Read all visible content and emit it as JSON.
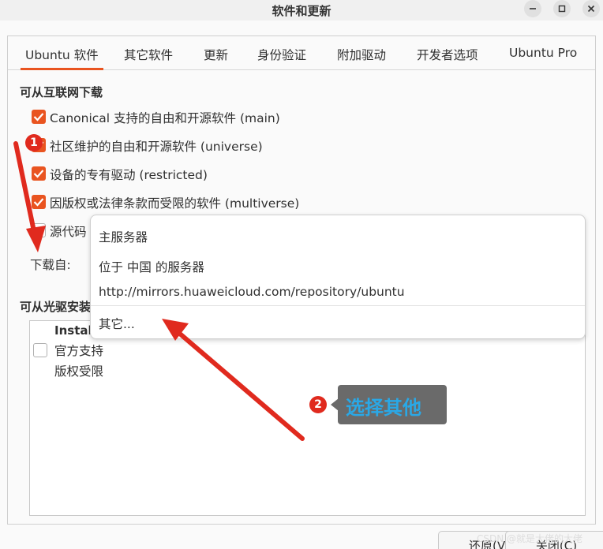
{
  "window": {
    "title": "软件和更新"
  },
  "tabs": [
    {
      "label": "Ubuntu 软件"
    },
    {
      "label": "其它软件"
    },
    {
      "label": "更新"
    },
    {
      "label": "身份验证"
    },
    {
      "label": "附加驱动"
    },
    {
      "label": "开发者选项"
    },
    {
      "label": "Ubuntu Pro"
    }
  ],
  "internet": {
    "heading": "可从互联网下载",
    "items": [
      {
        "label": "Canonical 支持的自由和开源软件 (main)",
        "checked": true
      },
      {
        "label": "社区维护的自由和开源软件 (universe)",
        "checked": true
      },
      {
        "label": "设备的专有驱动 (restricted)",
        "checked": true
      },
      {
        "label": "因版权或法律条款而受限的软件 (multiverse)",
        "checked": true
      },
      {
        "label": "源代码",
        "checked": false
      }
    ],
    "download_from_label": "下载自:"
  },
  "cdrom": {
    "heading": "可从光驱安装",
    "header": "Install",
    "line1": "官方支持",
    "line2": "版权受限"
  },
  "server_menu": {
    "items": [
      {
        "label": "主服务器"
      },
      {
        "label": "位于 中国 的服务器"
      },
      {
        "label": "http://mirrors.huaweicloud.com/repository/ubuntu"
      },
      {
        "label": "其它..."
      }
    ]
  },
  "buttons": {
    "revert": "还原(V)",
    "close": "关闭(C)"
  },
  "annotations": {
    "badge1": "1",
    "badge2": "2",
    "callout": "选择其他",
    "watermark": "CSDN @就是大佬的大佬"
  },
  "colors": {
    "accent": "#e95420",
    "annotation_red": "#e02a1e",
    "callout_text": "#2aa8e6"
  }
}
